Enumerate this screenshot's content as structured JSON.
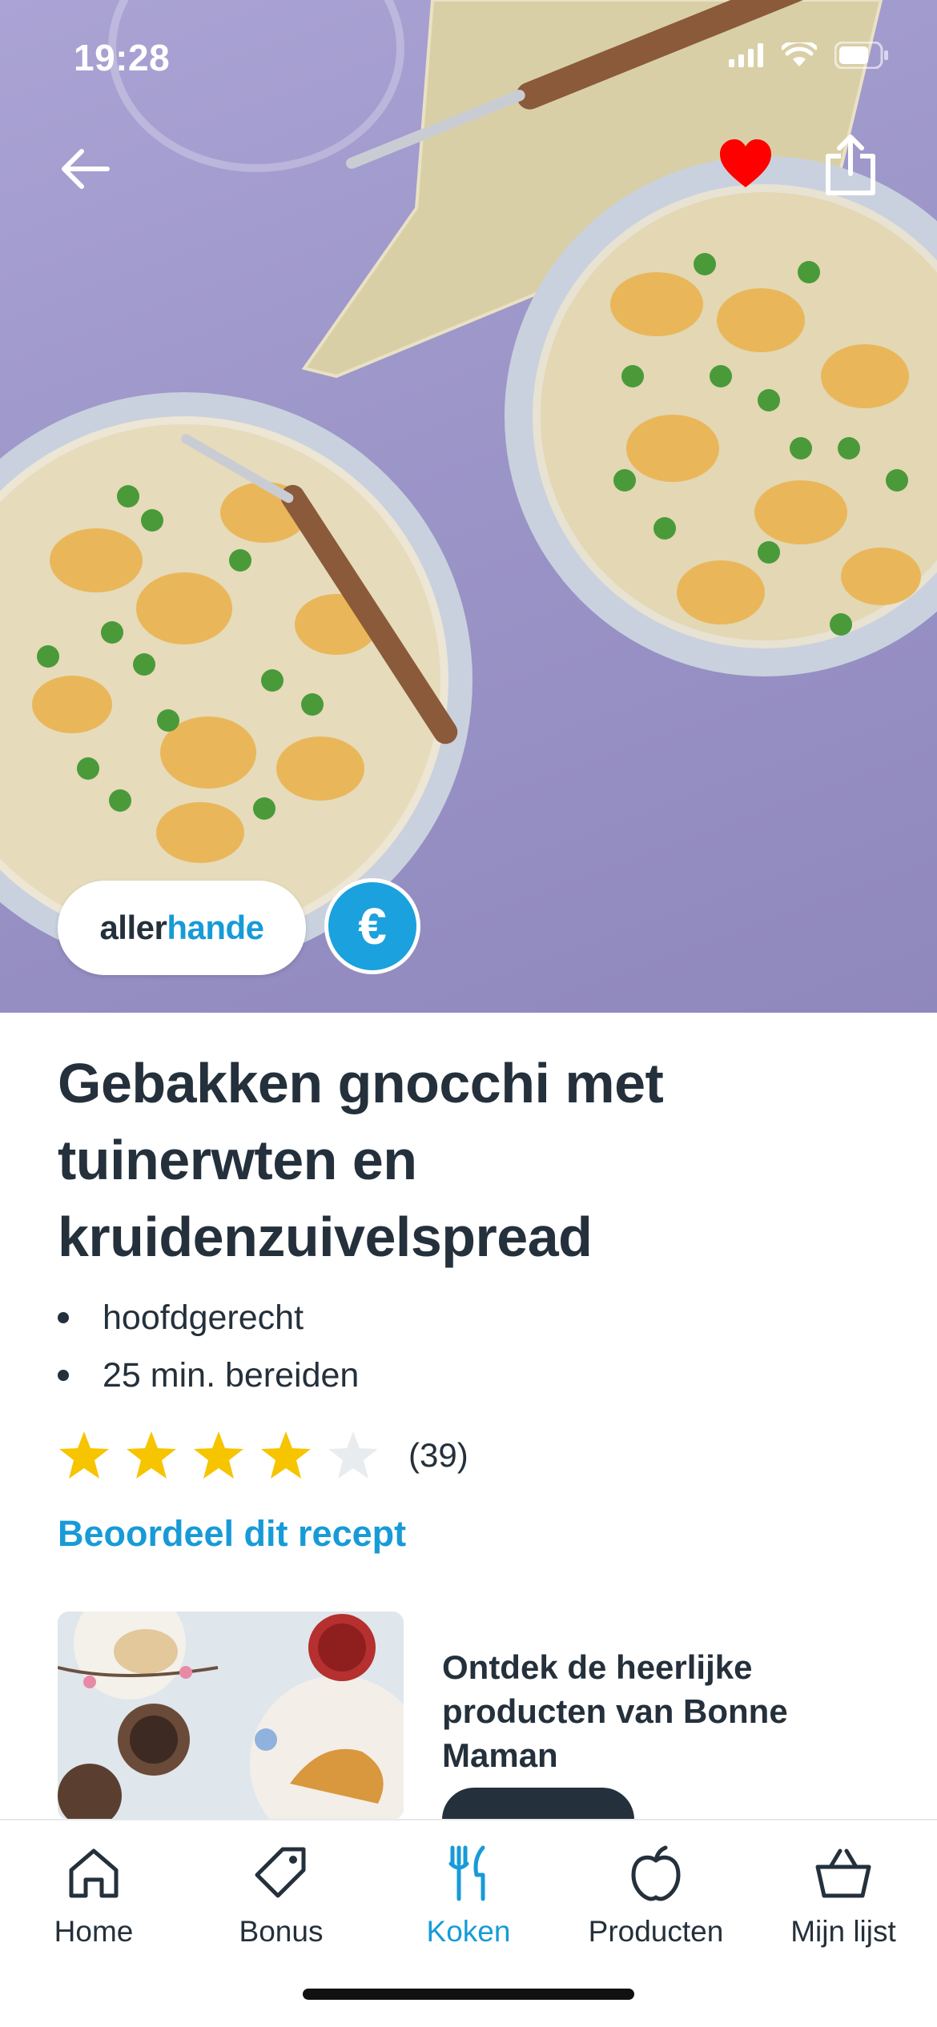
{
  "status_bar": {
    "time": "19:28"
  },
  "hero": {
    "brand_part1": "aller",
    "brand_part2": "hande",
    "euro_symbol": "€",
    "icons": [
      "back-arrow-icon",
      "heart-icon",
      "share-icon"
    ],
    "favorite_color": "#ff0000"
  },
  "recipe": {
    "title": "Gebakken gnocchi met tuinerwten en kruidenzuivelspread",
    "meta": [
      "hoofdgerecht",
      "25 min. bereiden"
    ],
    "rating_value": 4,
    "rating_max": 5,
    "rating_count": "(39)",
    "rate_link": "Beoordeel dit recept"
  },
  "promo": {
    "title": "Ontdek de heerlijke producten van Bonne Maman"
  },
  "tabbar": {
    "items": [
      {
        "label": "Home",
        "icon": "home-icon"
      },
      {
        "label": "Bonus",
        "icon": "tag-icon"
      },
      {
        "label": "Koken",
        "icon": "fork-knife-icon",
        "active": true
      },
      {
        "label": "Producten",
        "icon": "apple-icon"
      },
      {
        "label": "Mijn lijst",
        "icon": "basket-icon"
      }
    ],
    "active_color": "#179bd7"
  }
}
